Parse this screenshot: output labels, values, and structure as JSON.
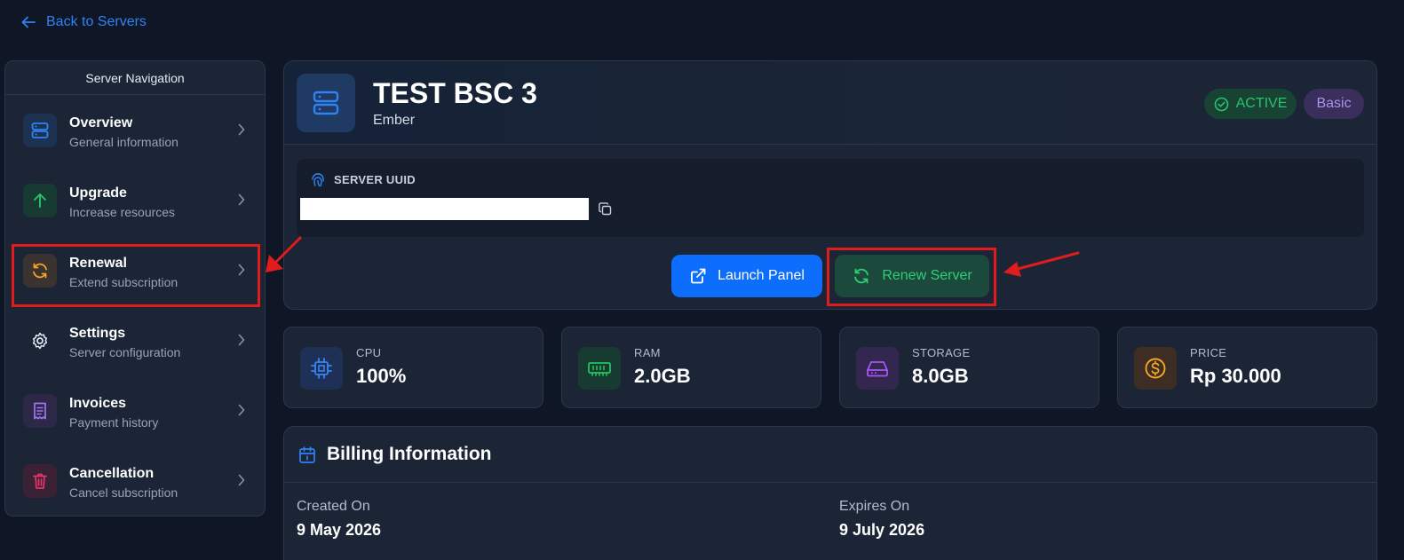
{
  "back_link": {
    "label": "Back to Servers"
  },
  "sidebar": {
    "title": "Server Navigation",
    "items": [
      {
        "label": "Overview",
        "sub": "General information",
        "icon": "server-icon",
        "color": "#2f83f5"
      },
      {
        "label": "Upgrade",
        "sub": "Increase resources",
        "icon": "arrow-up-icon",
        "color": "#29c46b"
      },
      {
        "label": "Renewal",
        "sub": "Extend subscription",
        "icon": "refresh-icon",
        "color": "#f5a524"
      },
      {
        "label": "Settings",
        "sub": "Server configuration",
        "icon": "gear-icon",
        "color": "#c8d0de"
      },
      {
        "label": "Invoices",
        "sub": "Payment history",
        "icon": "receipt-icon",
        "color": "#a076f0"
      },
      {
        "label": "Cancellation",
        "sub": "Cancel subscription",
        "icon": "trash-icon",
        "color": "#e8336a"
      }
    ]
  },
  "server": {
    "name": "TEST BSC 3",
    "game": "Ember",
    "status": "ACTIVE",
    "plan": "Basic",
    "uuid_label": "SERVER UUID",
    "uuid_value": "",
    "launch_label": "Launch Panel",
    "renew_label": "Renew Server"
  },
  "stats": [
    {
      "label": "CPU",
      "value": "100%",
      "icon": "cpu-icon",
      "color": "#3b82f6"
    },
    {
      "label": "RAM",
      "value": "2.0GB",
      "icon": "memory-icon",
      "color": "#22c55e"
    },
    {
      "label": "STORAGE",
      "value": "8.0GB",
      "icon": "hard-drive-icon",
      "color": "#a855f7"
    },
    {
      "label": "PRICE",
      "value": "Rp 30.000",
      "icon": "dollar-coin-icon",
      "color": "#f5a524"
    }
  ],
  "billing": {
    "title": "Billing Information",
    "created_label": "Created On",
    "created_value": "9 May 2026",
    "expires_label": "Expires On",
    "expires_value": "9 July 2026"
  }
}
